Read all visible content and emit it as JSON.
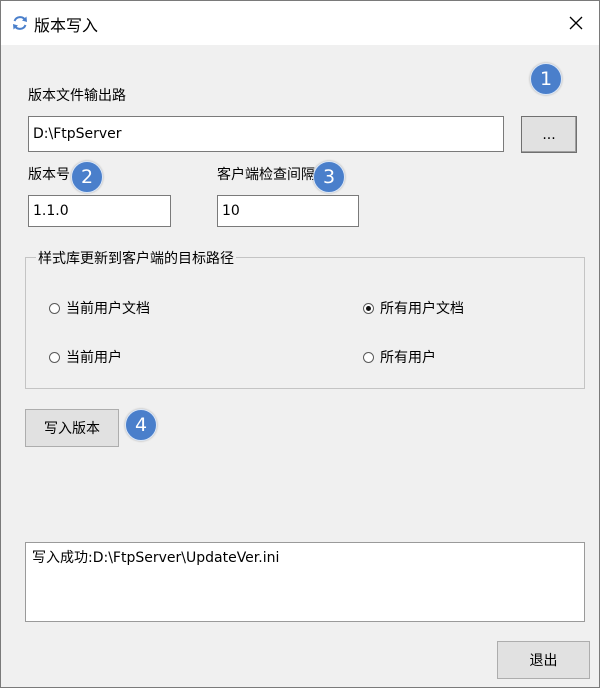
{
  "window": {
    "title": "版本写入"
  },
  "form": {
    "output_path_label": "版本文件输出路",
    "output_path_value": "D:\\FtpServer",
    "browse_label": "...",
    "version_label": "版本号",
    "version_value": "1.1.0",
    "interval_label": "客户端检查间隔(",
    "interval_value": "10"
  },
  "style_group": {
    "legend": "样式库更新到客户端的目标路径",
    "options": [
      {
        "label": "当前用户文档",
        "selected": false
      },
      {
        "label": "所有用户文档",
        "selected": true
      },
      {
        "label": "当前用户",
        "selected": false
      },
      {
        "label": "所有用户",
        "selected": false
      }
    ]
  },
  "write_button_label": "写入版本",
  "output_log": "写入成功:D:\\FtpServer\\UpdateVer.ini",
  "exit_button_label": "退出",
  "badges": [
    "1",
    "2",
    "3",
    "4"
  ],
  "colors": {
    "badge": "#4a7fcb",
    "titlebar": "#ffffff",
    "window": "#f0f0f0"
  }
}
